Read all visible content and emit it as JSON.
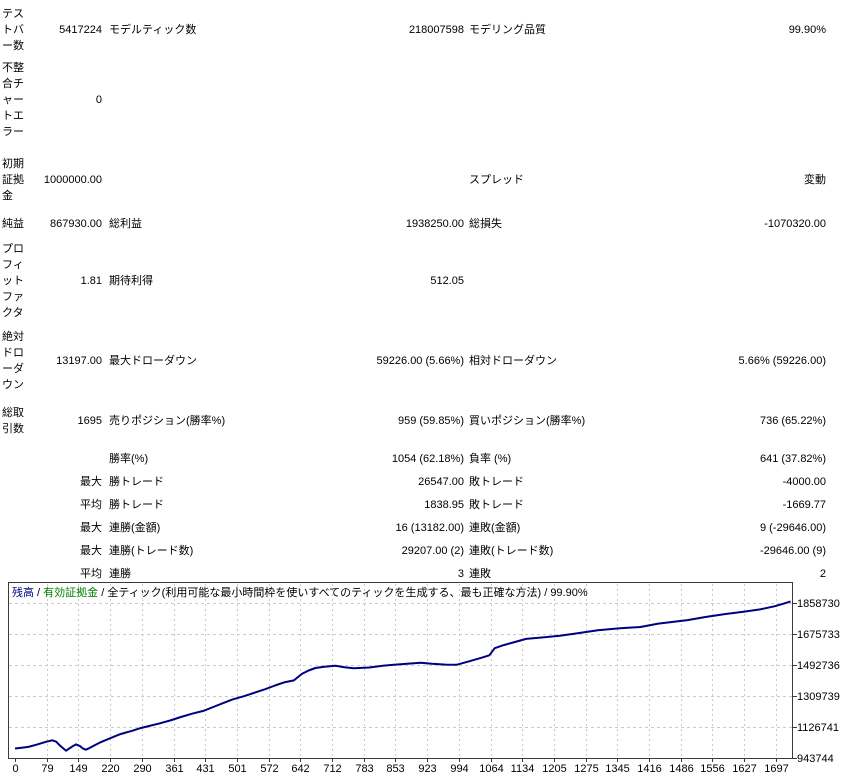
{
  "report": {
    "rows": [
      {
        "c1": "テストバー数",
        "v2": "5417224",
        "c3": "モデルティック数",
        "v4": "218007598",
        "c5": "モデリング品質",
        "v6": "99.90%"
      },
      {
        "c1": "不整合チャートエラー",
        "v2": "0",
        "c3": "",
        "v4": "",
        "c5": "",
        "v6": ""
      },
      {
        "c1": "初期証拠金",
        "v2": "1000000.00",
        "c3": "",
        "v4": "",
        "c5": "スプレッド",
        "v6": "変動"
      },
      {
        "c1": "純益",
        "v2": "867930.00",
        "c3": "総利益",
        "v4": "1938250.00",
        "c5": "総損失",
        "v6": "-1070320.00"
      },
      {
        "c1": "プロフィットファクタ",
        "v2": "1.81",
        "c3": "期待利得",
        "v4": "512.05",
        "c5": "",
        "v6": ""
      },
      {
        "c1": "絶対ドローダウン",
        "v2": "13197.00",
        "c3": "最大ドローダウン",
        "v4": "59226.00 (5.66%)",
        "c5": "相対ドローダウン",
        "v6": "5.66% (59226.00)"
      },
      {
        "c1": "総取引数",
        "v2": "1695",
        "c3": "売りポジション(勝率%)",
        "v4": "959 (59.85%)",
        "c5": "買いポジション(勝率%)",
        "v6": "736 (65.22%)"
      },
      {
        "c1": "",
        "v2": "",
        "c3": "勝率(%)",
        "v4": "1054 (62.18%)",
        "c5": "負率 (%)",
        "v6": "641 (37.82%)"
      },
      {
        "c1": "",
        "v2": "最大",
        "c3": "勝トレード",
        "v4": "26547.00",
        "c5": "敗トレード",
        "v6": "-4000.00"
      },
      {
        "c1": "",
        "v2": "平均",
        "c3": "勝トレード",
        "v4": "1838.95",
        "c5": "敗トレード",
        "v6": "-1669.77"
      },
      {
        "c1": "",
        "v2": "最大",
        "c3": "連勝(金額)",
        "v4": "16 (13182.00)",
        "c5": "連敗(金額)",
        "v6": "9 (-29646.00)"
      },
      {
        "c1": "",
        "v2": "最大",
        "c3": "連勝(トレード数)",
        "v4": "29207.00 (2)",
        "c5": "連敗(トレード数)",
        "v6": "-29646.00 (9)"
      },
      {
        "c1": "",
        "v2": "平均",
        "c3": "連勝",
        "v4": "3",
        "c5": "連敗",
        "v6": "2"
      }
    ]
  },
  "chart": {
    "legend_balance": "残高",
    "legend_equity": "有効証拠金",
    "separator": " / ",
    "model_desc": "全ティック(利用可能な最小時間枠を使いすべてのティックを生成する、最も正確な方法)",
    "quality": "99.90%",
    "balance_color": "#000080",
    "equity_color": "#008000",
    "grid_color": "#cfc7cf",
    "frame_color": "#3a3a3a"
  },
  "chart_data": {
    "type": "line",
    "title": "残高 / 有効証拠金 / 全ティック(利用可能な最小時間枠を使いすべてのティックを生成する、最も正確な方法) / 99.90%",
    "xlabel": "",
    "ylabel": "",
    "x_ticks": [
      0,
      79,
      149,
      220,
      290,
      361,
      431,
      501,
      572,
      642,
      712,
      783,
      853,
      923,
      994,
      1064,
      1134,
      1205,
      1275,
      1345,
      1416,
      1486,
      1556,
      1627,
      1697
    ],
    "y_ticks": [
      943744,
      1126741,
      1309739,
      1492736,
      1675733,
      1858730
    ],
    "x_range": [
      0,
      1740
    ],
    "y_range": [
      943744,
      1982672
    ],
    "grid": true,
    "legend_position": "top-left",
    "series": [
      {
        "name": "残高",
        "color": "#000080",
        "points": [
          [
            0,
            1000000
          ],
          [
            15,
            1004000
          ],
          [
            30,
            1009000
          ],
          [
            48,
            1022000
          ],
          [
            70,
            1040000
          ],
          [
            83,
            1048000
          ],
          [
            92,
            1040000
          ],
          [
            100,
            1018000
          ],
          [
            108,
            1000000
          ],
          [
            114,
            987000
          ],
          [
            120,
            998000
          ],
          [
            128,
            1012000
          ],
          [
            136,
            1024000
          ],
          [
            145,
            1014000
          ],
          [
            152,
            999000
          ],
          [
            158,
            993000
          ],
          [
            165,
            1001000
          ],
          [
            175,
            1015000
          ],
          [
            190,
            1036000
          ],
          [
            212,
            1060000
          ],
          [
            235,
            1085000
          ],
          [
            262,
            1105000
          ],
          [
            280,
            1120000
          ],
          [
            300,
            1133000
          ],
          [
            320,
            1146000
          ],
          [
            346,
            1165000
          ],
          [
            370,
            1186000
          ],
          [
            395,
            1205000
          ],
          [
            420,
            1222000
          ],
          [
            445,
            1248000
          ],
          [
            468,
            1272000
          ],
          [
            486,
            1290000
          ],
          [
            510,
            1308000
          ],
          [
            535,
            1330000
          ],
          [
            558,
            1350000
          ],
          [
            580,
            1372000
          ],
          [
            600,
            1390000
          ],
          [
            622,
            1402000
          ],
          [
            640,
            1440000
          ],
          [
            655,
            1460000
          ],
          [
            670,
            1475000
          ],
          [
            690,
            1482000
          ],
          [
            715,
            1488000
          ],
          [
            735,
            1480000
          ],
          [
            755,
            1473000
          ],
          [
            790,
            1478000
          ],
          [
            820,
            1488000
          ],
          [
            845,
            1494000
          ],
          [
            875,
            1500000
          ],
          [
            905,
            1506000
          ],
          [
            930,
            1500000
          ],
          [
            960,
            1495000
          ],
          [
            985,
            1494000
          ],
          [
            1010,
            1512000
          ],
          [
            1040,
            1535000
          ],
          [
            1058,
            1550000
          ],
          [
            1070,
            1592000
          ],
          [
            1090,
            1610000
          ],
          [
            1110,
            1625000
          ],
          [
            1140,
            1647000
          ],
          [
            1175,
            1655000
          ],
          [
            1215,
            1665000
          ],
          [
            1255,
            1680000
          ],
          [
            1300,
            1698000
          ],
          [
            1350,
            1710000
          ],
          [
            1395,
            1717000
          ],
          [
            1435,
            1737000
          ],
          [
            1470,
            1748000
          ],
          [
            1500,
            1758000
          ],
          [
            1540,
            1776000
          ],
          [
            1585,
            1794000
          ],
          [
            1625,
            1807000
          ],
          [
            1662,
            1821000
          ],
          [
            1695,
            1840000
          ],
          [
            1715,
            1855000
          ],
          [
            1730,
            1867930
          ]
        ]
      }
    ]
  }
}
